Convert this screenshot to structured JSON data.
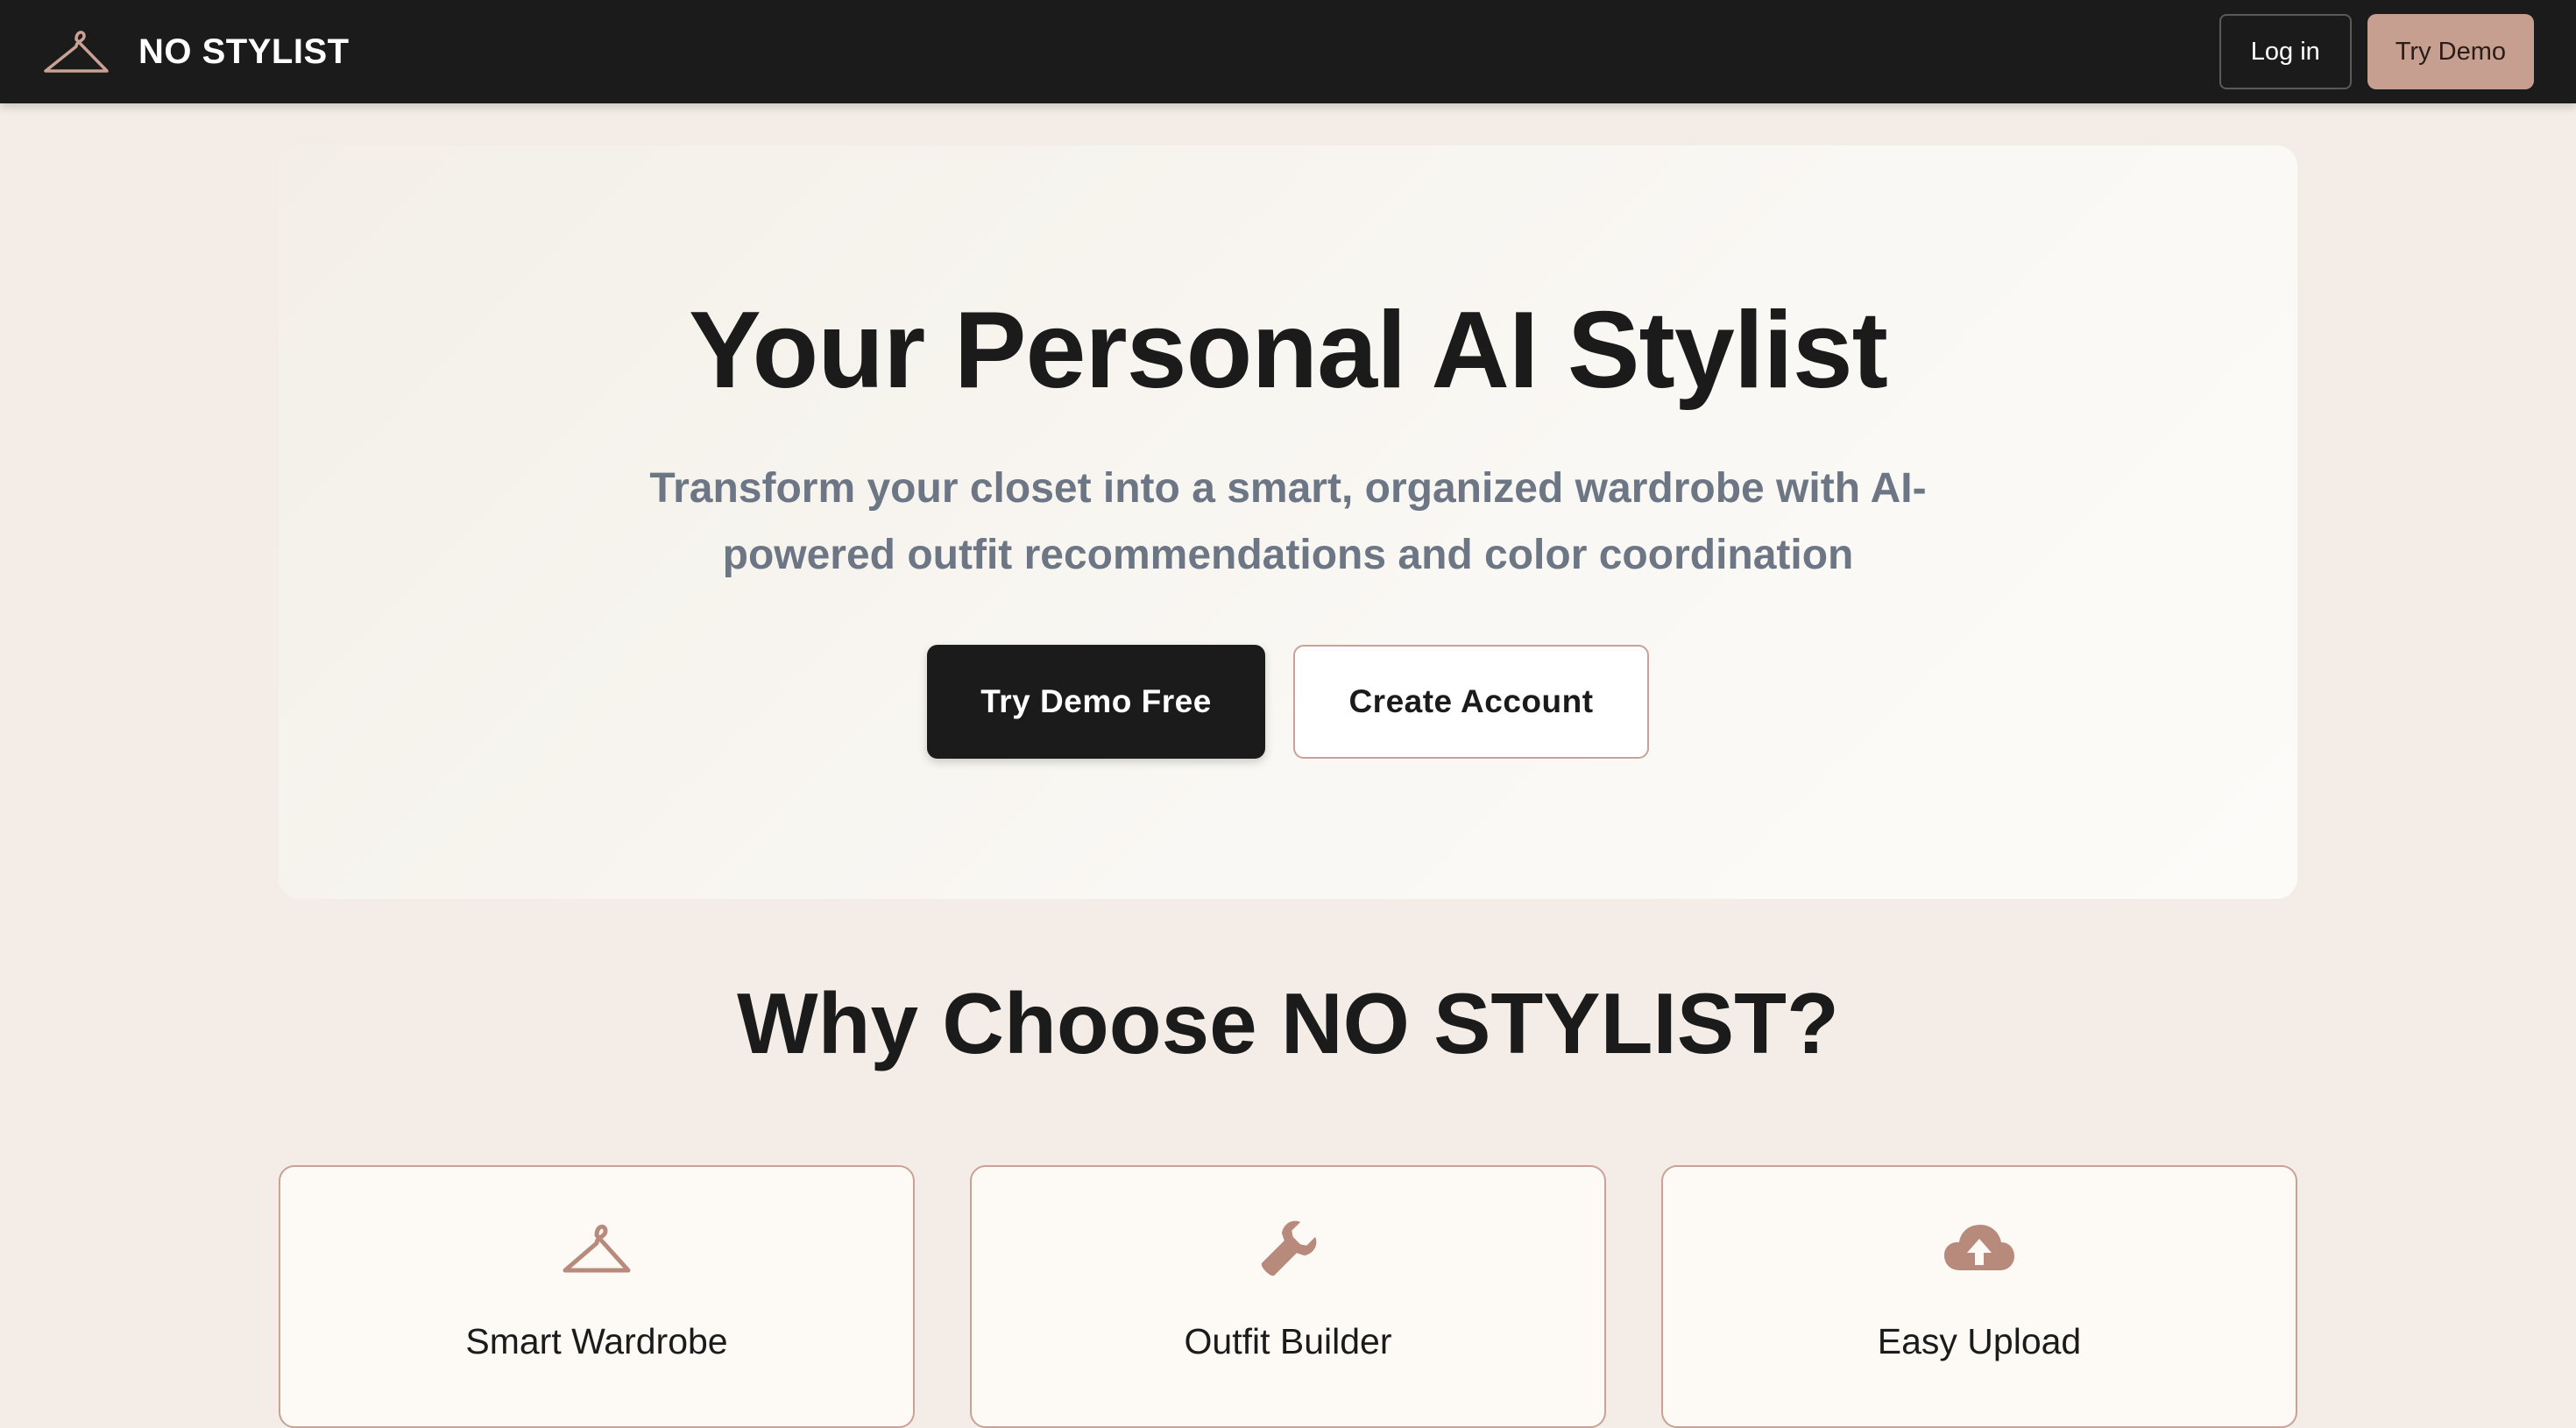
{
  "header": {
    "brand_name": "NO STYLIST",
    "brand_icon": "hanger-icon",
    "login_label": "Log in",
    "try_demo_label": "Try Demo"
  },
  "hero": {
    "title": "Your Personal AI Stylist",
    "subtitle": "Transform your closet into a smart, organized wardrobe with AI-powered outfit recommendations and color coordination",
    "primary_cta": "Try Demo Free",
    "secondary_cta": "Create Account"
  },
  "features": {
    "heading": "Why Choose NO STYLIST?",
    "items": [
      {
        "title": "Smart Wardrobe",
        "icon": "hanger-icon"
      },
      {
        "title": "Outfit Builder",
        "icon": "wrench-icon"
      },
      {
        "title": "Easy Upload",
        "icon": "cloud-upload-icon"
      }
    ]
  },
  "colors": {
    "navbar_bg": "#1b1b1b",
    "page_bg": "#f4ede7",
    "accent": "#c79f91",
    "subtitle_text": "#6c7685"
  }
}
